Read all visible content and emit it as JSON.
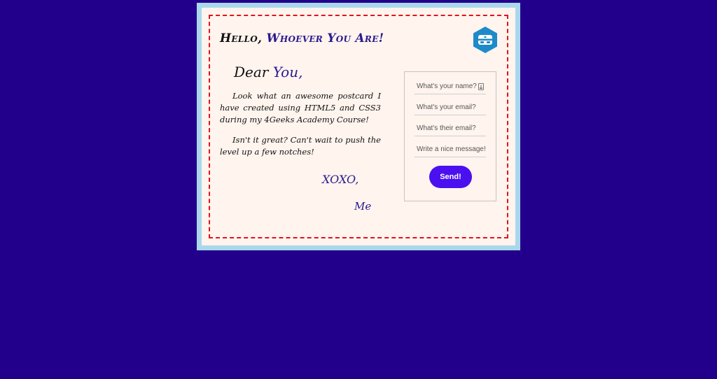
{
  "header": {
    "title_part1": "Hello, ",
    "title_part2": "Whoever You Are!"
  },
  "logo": {
    "icon": "4geeks-logo-icon",
    "color": "#1e8ac9"
  },
  "letter": {
    "greeting_part1": "Dear ",
    "greeting_part2": "You,",
    "paragraph1": "Look what an awesome postcard I have created using HTML5 and CSS3 during my 4Geeks Academy Course!",
    "paragraph2": "Isn't it great? Can't wait to push the level up a few notches!",
    "closing": "XOXO,",
    "signature": "Me"
  },
  "form": {
    "name_placeholder": "What's your name?",
    "email_placeholder": "What's your email?",
    "their_email_placeholder": "What's their email?",
    "message_placeholder": "Write a nice message!",
    "send_label": "Send!"
  },
  "colors": {
    "page_background": "#23008c",
    "postcard_frame": "#a9d8ec",
    "paper": "#fff4ee",
    "dashed_border": "#e0141c",
    "accent_text": "#2a1a8e",
    "send_button": "#4a10f0"
  }
}
